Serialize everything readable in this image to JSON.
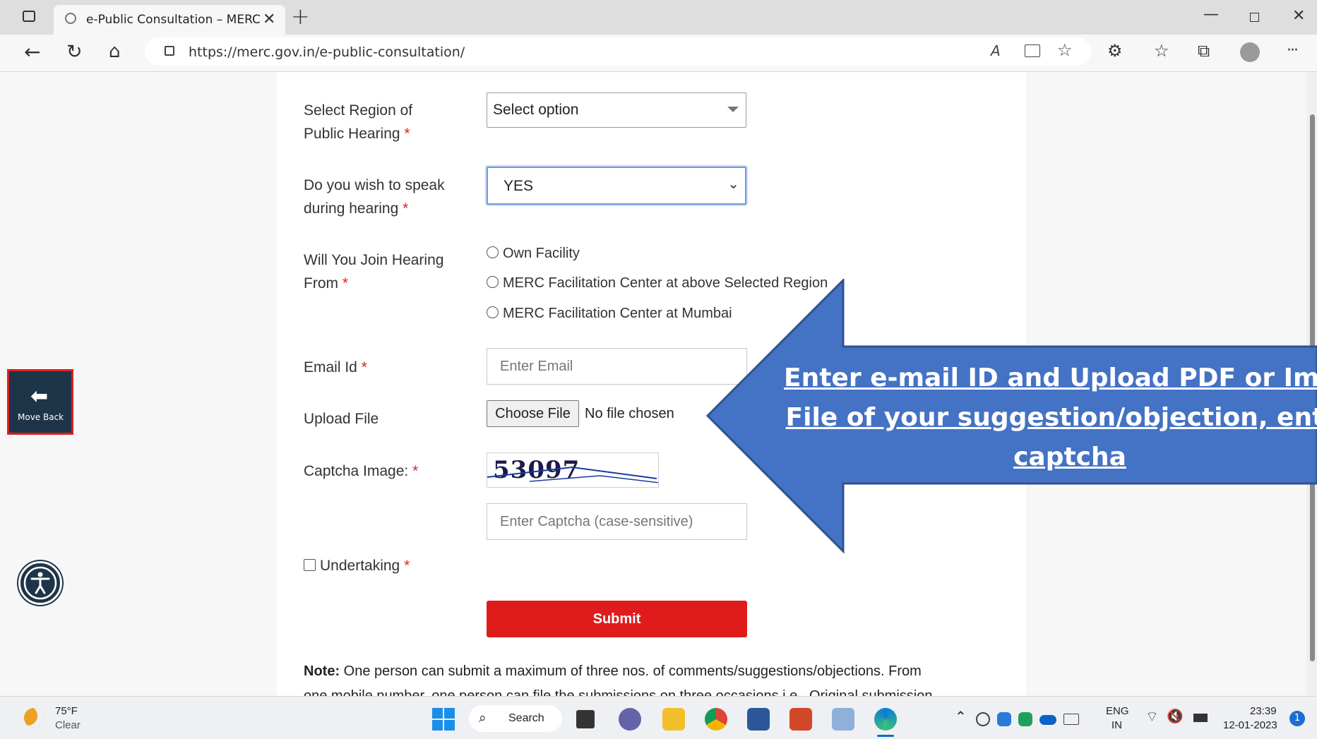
{
  "browser": {
    "tab_title": "e-Public Consultation – MERC",
    "url": "https://merc.gov.in/e-public-consultation/",
    "new_tab": "+",
    "more": "···",
    "read_aloud": "A"
  },
  "form": {
    "region_label": "Select Region of Public Hearing",
    "region_value": "Select option",
    "speak_label": "Do you wish to speak during hearing",
    "speak_value": "YES",
    "join_label": "Will You Join Hearing From",
    "join_options": [
      "Own Facility",
      "MERC Facilitation Center at above Selected Region",
      "MERC Facilitation Center at Mumbai"
    ],
    "email_label": "Email Id",
    "email_placeholder": "Enter Email",
    "upload_label": "Upload File",
    "choose_file": "Choose File",
    "no_file": "No file chosen",
    "captcha_label": "Captcha Image:",
    "captcha_text": "53097",
    "captcha_placeholder": "Enter Captcha (case-sensitive)",
    "undertaking": "Undertaking",
    "required_mark": "*",
    "submit": "Submit",
    "note_label": "Note:",
    "note_text": "One person can submit a maximum of three nos. of comments/suggestions/objections. From",
    "note_text_2": "one mobile number, one person can file the submissions on three occasions i.e., Original submission"
  },
  "side": {
    "move_back": "Move Back"
  },
  "callout": {
    "line1": "Enter e-mail ID and Upload PDF or Image",
    "line2": "File of your suggestion/objection, enter",
    "line3": "captcha"
  },
  "taskbar": {
    "weather_temp": "75°F",
    "weather_desc": "Clear",
    "search": "Search",
    "lang": "ENG",
    "region": "IN",
    "time": "23:39",
    "date": "12-01-2023",
    "notification_count": "1"
  },
  "colors": {
    "accent_red": "#e01b1b",
    "callout_blue": "#4472c4",
    "move_back_bg": "#1e3448"
  }
}
